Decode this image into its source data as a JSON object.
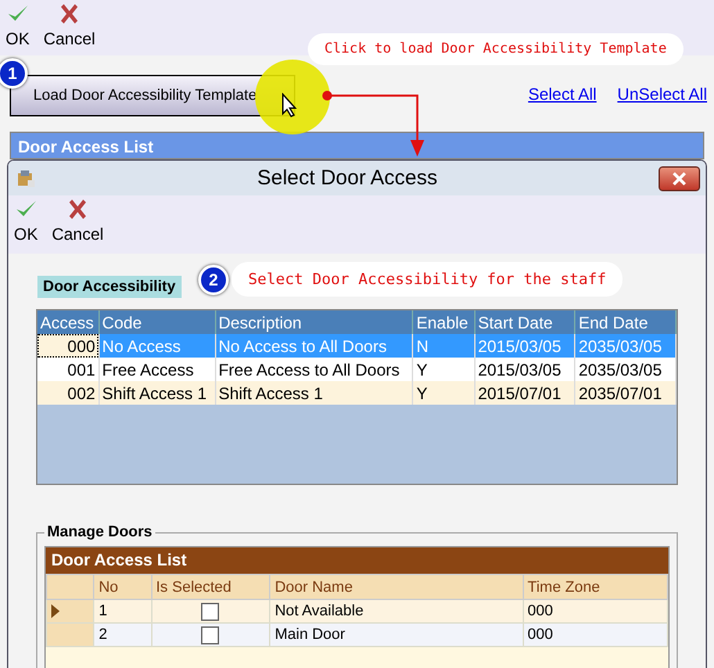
{
  "toolbar": {
    "buttons": [
      {
        "label": "OK",
        "kind": "ok"
      },
      {
        "label": "Cancel",
        "kind": "cancel"
      }
    ]
  },
  "step_1": {
    "number": "1",
    "callout": "Click to load Door Accessibility Template"
  },
  "load_button": {
    "label": "Load Door Accessibility Template"
  },
  "links": [
    "Select All",
    "UnSelect All"
  ],
  "panel_title": "Door Access List",
  "dialog": {
    "title": "Select Door Access",
    "toolbar": {
      "buttons": [
        {
          "label": "OK",
          "kind": "ok"
        },
        {
          "label": "Cancel",
          "kind": "cancel"
        }
      ]
    },
    "section_label": "Door Accessibility",
    "step_2": {
      "number": "2",
      "callout": "Select Door Accessibility for the staff"
    },
    "table": {
      "columns": [
        "Access",
        "Code",
        "Description",
        "Enable",
        "Start Date",
        "End Date"
      ],
      "rows": [
        {
          "selected": true,
          "cells": [
            "000",
            "No Access",
            "No Access to All Doors",
            "N",
            "2015/03/05",
            "2035/03/05"
          ]
        },
        {
          "selected": false,
          "cells": [
            "001",
            "Free Access",
            "Free Access to All Doors",
            "Y",
            "2015/03/05",
            "2035/03/05"
          ]
        },
        {
          "selected": false,
          "cells": [
            "002",
            "Shift Access 1",
            "Shift Access 1",
            "Y",
            "2015/07/01",
            "2035/07/01"
          ]
        }
      ]
    },
    "manage_doors": {
      "title": "Manage Doors",
      "grid_title": "Door Access List",
      "columns": [
        "No",
        "Is Selected",
        "Door Name",
        "Time Zone"
      ],
      "rows": [
        {
          "current": true,
          "checked": false,
          "no": "1",
          "door_name": "Not Available",
          "time_zone": "000"
        },
        {
          "current": false,
          "checked": false,
          "no": "2",
          "door_name": "Main Door",
          "time_zone": "000"
        }
      ]
    }
  }
}
